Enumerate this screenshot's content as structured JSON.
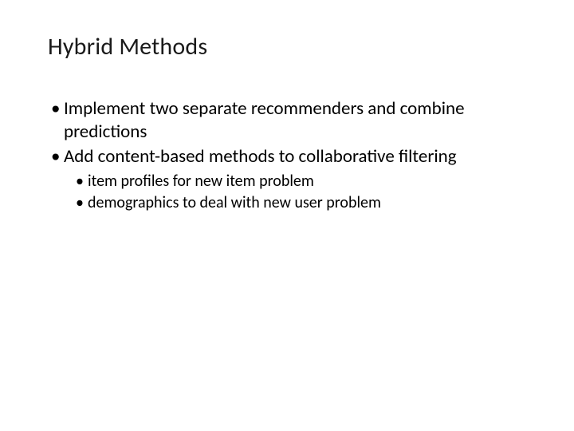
{
  "slide": {
    "title": "Hybrid Methods",
    "bullets": [
      {
        "level": 1,
        "text": "Implement two separate recommenders and combine predictions"
      },
      {
        "level": 1,
        "text": "Add content-based methods to collaborative filtering"
      },
      {
        "level": 2,
        "text": "item profiles for new item problem"
      },
      {
        "level": 2,
        "text": "demographics to deal with new user problem"
      }
    ]
  }
}
